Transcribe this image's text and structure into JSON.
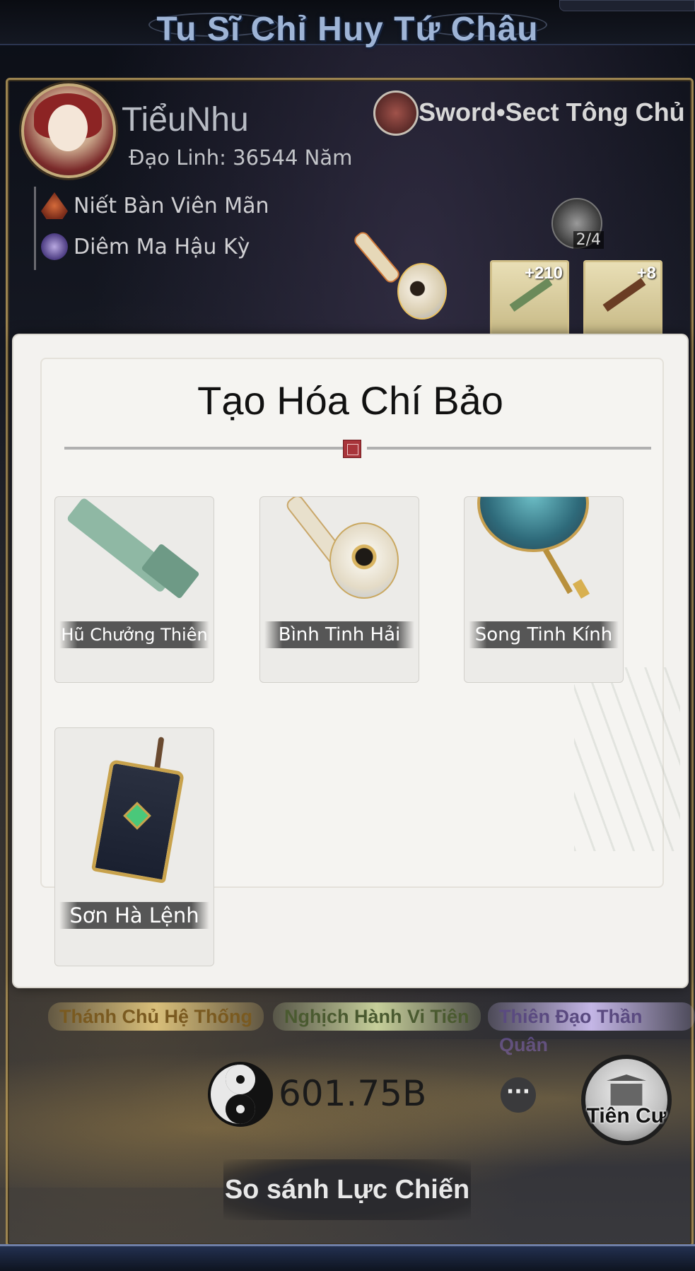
{
  "header": {
    "title": "Tu Sĩ Chỉ Huy Tứ Châu"
  },
  "profile": {
    "name": "TiểuNhu",
    "age_label": "Đạo Linh: 36544 Năm",
    "sect": "Sword•Sect  Tông Chủ",
    "realms": [
      "Niết Bàn Viên Mãn",
      "Diêm Ma Hậu Kỳ"
    ],
    "slot_count": "2/4",
    "equipment": [
      {
        "level": "+210",
        "icon": "jade-sword-icon"
      },
      {
        "level": "+8",
        "icon": "bronze-sword-icon"
      }
    ]
  },
  "modal": {
    "title": "Tạo Hóa Chí Bảo",
    "items": [
      {
        "label": "Hũ Chưởng Thiên",
        "icon": "jade-relic-icon"
      },
      {
        "label": "Bình Tinh Hải",
        "icon": "star-sea-bottle-icon"
      },
      {
        "label": "Song Tinh Kính",
        "icon": "twin-star-mirror-icon"
      },
      {
        "label": "Sơn Hà Lệnh",
        "icon": "mountain-river-token-icon"
      }
    ]
  },
  "titles": [
    "Thánh Chủ Hệ Thống",
    "Nghịch Hành Vi Tiên",
    "Thiên Đạo Thần Quân"
  ],
  "currency": {
    "amount": "601.75B",
    "icon": "yin-yang-icon"
  },
  "buttons": {
    "more": "···",
    "immortal_residence": "Tiên Cư",
    "compare_power": "So sánh Lực Chiến"
  }
}
